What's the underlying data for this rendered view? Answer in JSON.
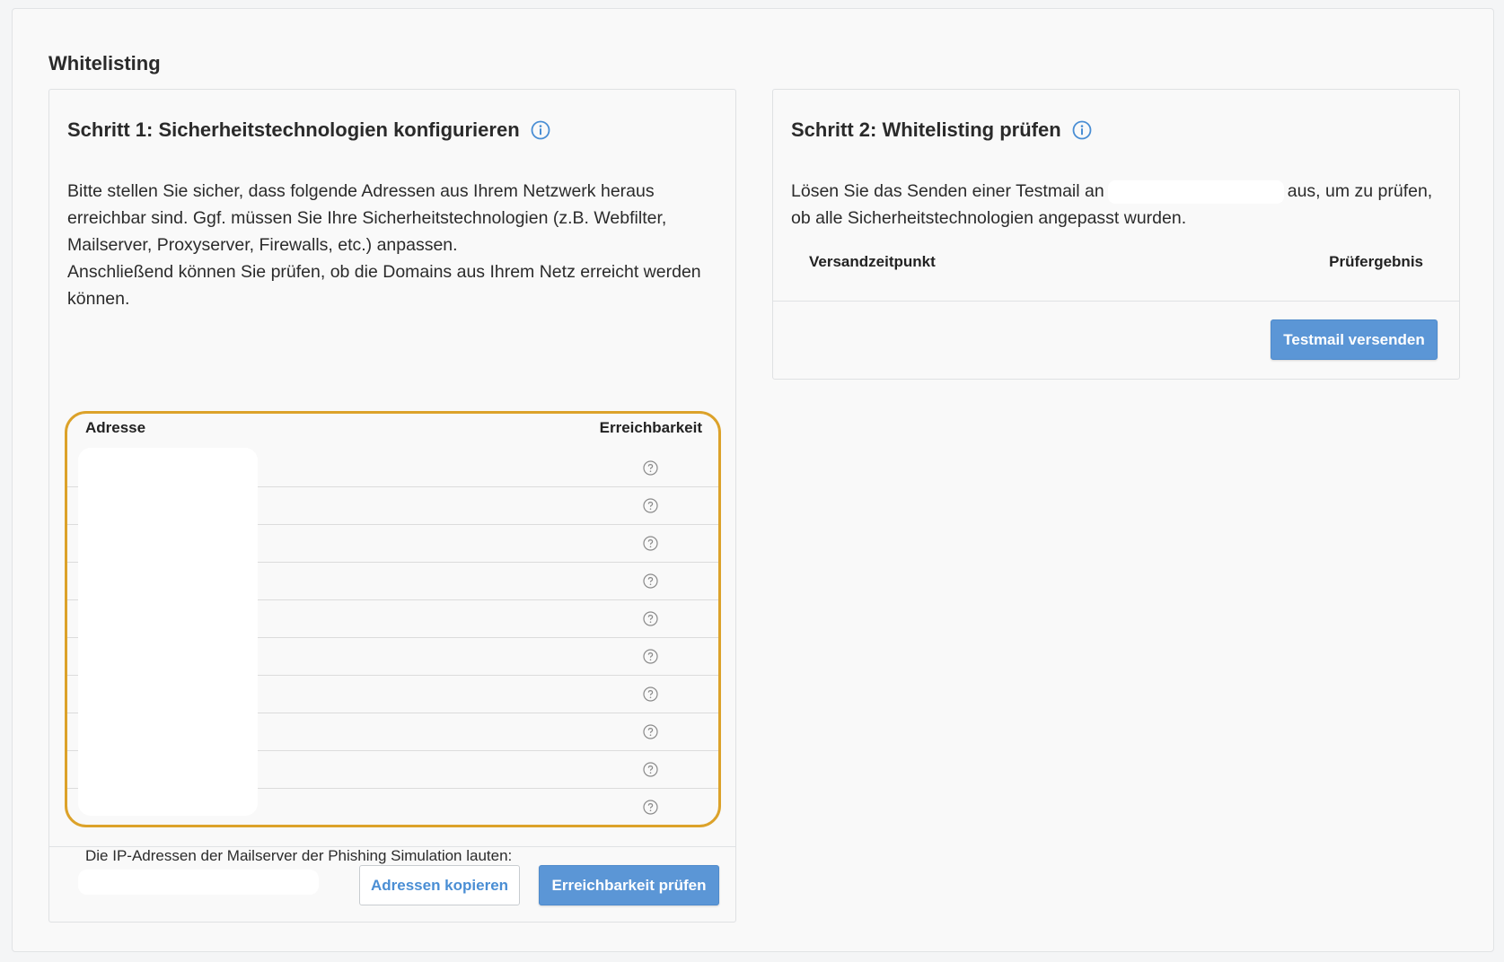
{
  "page": {
    "title": "Whitelisting"
  },
  "step1": {
    "title": "Schritt 1: Sicherheitstechnologien konfigurieren",
    "paragraph1": "Bitte stellen Sie sicher, dass folgende Adressen aus Ihrem Netzwerk heraus erreichbar sind. Ggf. müssen Sie Ihre Sicherheitstechnologien (z.B. Webfilter, Mailserver, Proxyserver, Firewalls, etc.) anpassen.",
    "paragraph2": "Anschließend können Sie prüfen, ob die Domains aus Ihrem Netz erreicht werden können.",
    "table": {
      "col_address": "Adresse",
      "col_reachability": "Erreichbarkeit",
      "row_status_icon": "question-circle-icon",
      "row_count": 10
    },
    "ip_text": "Die IP-Adressen der Mailserver der Phishing Simulation lauten:",
    "copy_button": "Adressen kopieren",
    "check_button": "Erreichbarkeit prüfen"
  },
  "step2": {
    "title": "Schritt 2: Whitelisting prüfen",
    "text_before": "Lösen Sie das Senden einer Testmail an",
    "text_after": "aus, um zu prüfen, ob alle Sicherheitstechnologien angepasst wurden.",
    "col_sent": "Versandzeitpunkt",
    "col_result": "Prüfergebnis",
    "send_button": "Testmail versenden"
  },
  "colors": {
    "accent": "#5b96d6",
    "highlight": "#dca22a",
    "info_icon": "#4a8ed4"
  }
}
